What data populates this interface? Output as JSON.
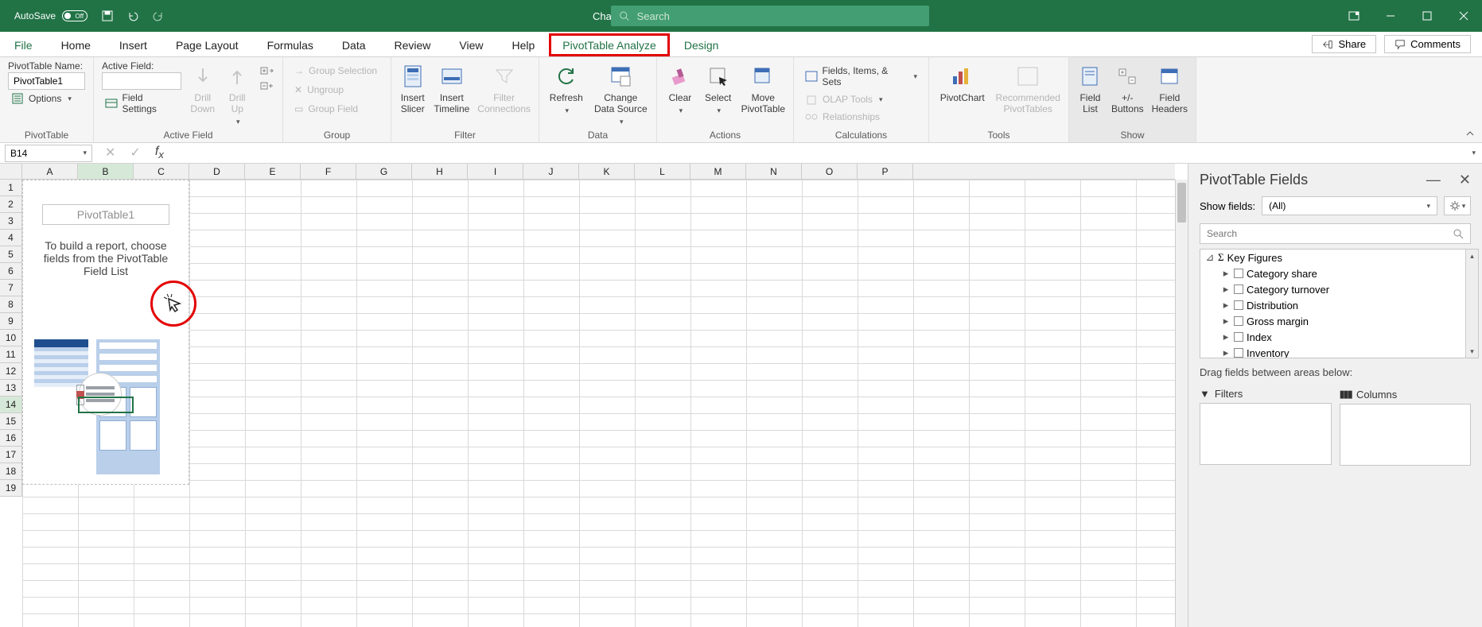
{
  "titlebar": {
    "autosave_label": "AutoSave",
    "autosave_state": "Off",
    "doc_title": "Changing a data source - Saved",
    "search_placeholder": "Search"
  },
  "tabs": {
    "file": "File",
    "home": "Home",
    "insert": "Insert",
    "page_layout": "Page Layout",
    "formulas": "Formulas",
    "data": "Data",
    "review": "Review",
    "view": "View",
    "help": "Help",
    "pivottable_analyze": "PivotTable Analyze",
    "design": "Design",
    "share": "Share",
    "comments": "Comments"
  },
  "ribbon": {
    "pivottable_group": {
      "name_label": "PivotTable Name:",
      "name_value": "PivotTable1",
      "options_label": "Options",
      "group_label": "PivotTable"
    },
    "active_field_group": {
      "field_label": "Active Field:",
      "field_value": "",
      "field_settings": "Field Settings",
      "drill_down": "Drill Down",
      "drill_up": "Drill Up",
      "group_label": "Active Field"
    },
    "group_group": {
      "selection": "Group Selection",
      "ungroup": "Ungroup",
      "field": "Group Field",
      "group_label": "Group"
    },
    "filter_group": {
      "insert_slicer": "Insert Slicer",
      "insert_timeline": "Insert Timeline",
      "filter_connections": "Filter Connections",
      "group_label": "Filter"
    },
    "data_group": {
      "refresh": "Refresh",
      "change_source": "Change Data Source",
      "group_label": "Data"
    },
    "actions_group": {
      "clear": "Clear",
      "select": "Select",
      "move": "Move PivotTable",
      "group_label": "Actions"
    },
    "calc_group": {
      "fields": "Fields, Items, & Sets",
      "olap": "OLAP Tools",
      "relationships": "Relationships",
      "group_label": "Calculations"
    },
    "tools_group": {
      "pivotchart": "PivotChart",
      "recommended": "Recommended PivotTables",
      "group_label": "Tools"
    },
    "show_group": {
      "field_list": "Field List",
      "buttons": "+/- Buttons",
      "headers": "Field Headers",
      "group_label": "Show"
    }
  },
  "name_box": "B14",
  "columns": [
    "A",
    "B",
    "C",
    "D",
    "E",
    "F",
    "G",
    "H",
    "I",
    "J",
    "K",
    "L",
    "M",
    "N",
    "O",
    "P"
  ],
  "rows": [
    1,
    2,
    3,
    4,
    5,
    6,
    7,
    8,
    9,
    10,
    11,
    12,
    13,
    14,
    15,
    16,
    17,
    18,
    19
  ],
  "pt_placeholder": {
    "name": "PivotTable1",
    "hint": "To build a report, choose fields from the PivotTable Field List"
  },
  "fields_pane": {
    "title": "PivotTable Fields",
    "show_fields_label": "Show fields:",
    "show_fields_value": "(All)",
    "search_placeholder": "Search",
    "tree": {
      "root": "Key Figures",
      "items": [
        "Category share",
        "Category turnover",
        "Distribution",
        "Gross margin",
        "Index",
        "Inventory"
      ]
    },
    "drag_label": "Drag fields between areas below:",
    "filters_label": "Filters",
    "columns_label": "Columns"
  }
}
